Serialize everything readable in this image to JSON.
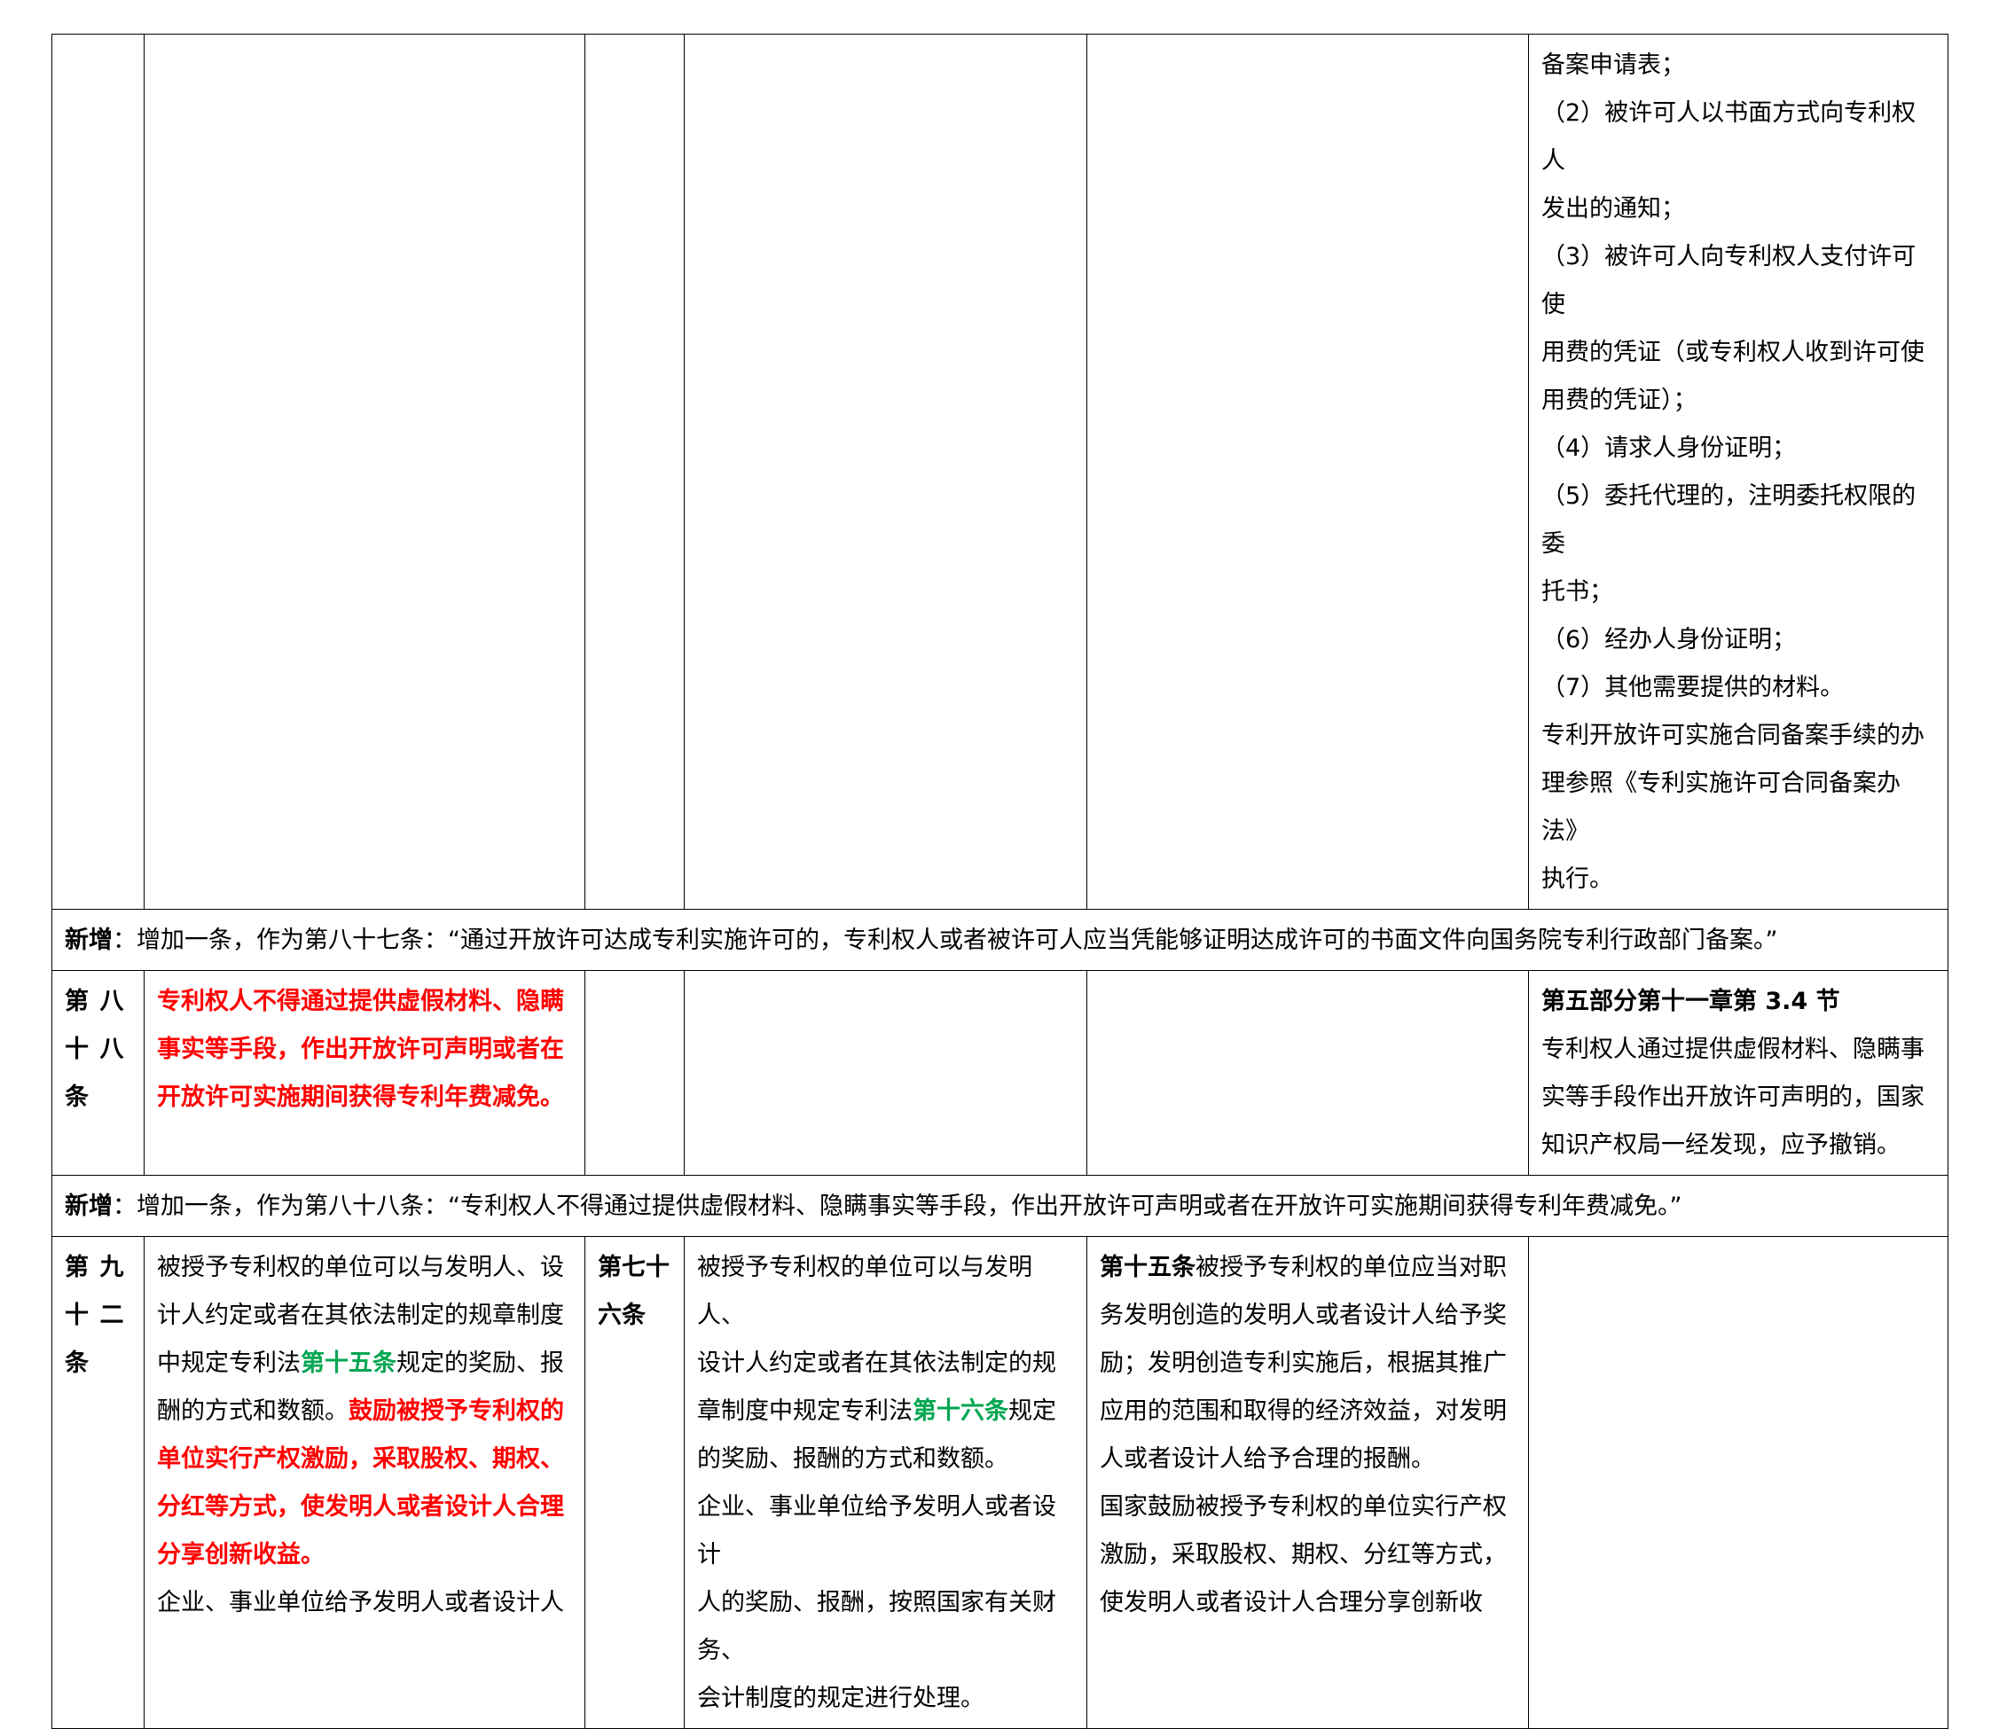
{
  "row_a": {
    "col6_lines": [
      "备案申请表；",
      "（2）被许可人以书面方式向专利权人",
      "发出的通知；",
      "（3）被许可人向专利权人支付许可使",
      "用费的凭证（或专利权人收到许可使",
      "用费的凭证）；",
      "（4）请求人身份证明；",
      "（5）委托代理的，注明委托权限的委",
      "托书；",
      "（6）经办人身份证明；",
      "（7）其他需要提供的材料。",
      "专利开放许可实施合同备案手续的办",
      "理参照《专利实施许可合同备案办法》",
      "执行。"
    ]
  },
  "note1": {
    "label": "新增",
    "text": "：增加一条，作为第八十七条：“通过开放许可达成专利实施许可的，专利权人或者被许可人应当凭能够证明达成许可的书面文件向国务院专利行政部门备案。”"
  },
  "row_b": {
    "article": [
      "第",
      "八",
      "十",
      "八",
      "条",
      ""
    ],
    "red_lines": [
      "专利权人不得通过提供虚假材料、隐瞒",
      "事实等手段，作出开放许可声明或者在",
      "开放许可实施期间获得专利年费减免。"
    ],
    "col6_heading": "第五部分第十一章第 3.4 节",
    "col6_lines": [
      "专利权人通过提供虚假材料、隐瞒事",
      "实等手段作出开放许可声明的，国家",
      "知识产权局一经发现，应予撤销。"
    ]
  },
  "note2": {
    "label": "新增",
    "text": "：增加一条，作为第八十八条：“专利权人不得通过提供虚假材料、隐瞒事实等手段，作出开放许可声明或者在开放许可实施期间获得专利年费减免。”"
  },
  "row_c": {
    "article": [
      "第",
      "九",
      "十",
      "二",
      "条",
      ""
    ],
    "col2": {
      "l1": "被授予专利权的单位可以与发明人、设",
      "l2": "计人约定或者在其依法制定的规章制度",
      "l3a": "中规定专利法",
      "l3g": "第十五条",
      "l3b": "规定的奖励、报",
      "l4a": "酬的方式和数额。",
      "l4r": "鼓励被授予专利权的",
      "r1": "单位实行产权激励，采取股权、期权、",
      "r2": "分红等方式，使发明人或者设计人合理",
      "r3": "分享创新收益。",
      "l5": "企业、事业单位给予发明人或者设计人"
    },
    "col3_article": [
      "第七十",
      "六条"
    ],
    "col4": {
      "l1": "被授予专利权的单位可以与发明人、",
      "l2": "设计人约定或者在其依法制定的规",
      "l3a": "章制度中规定专利法",
      "l3g": "第十六条",
      "l3b": "规定",
      "l4": "的奖励、报酬的方式和数额。",
      "l5": "企业、事业单位给予发明人或者设计",
      "l6": "人的奖励、报酬，按照国家有关财务、",
      "l7": "会计制度的规定进行处理。"
    },
    "col5": {
      "bold": "第十五条",
      "l1": "被授予专利权的单位应当对职",
      "l2": "务发明创造的发明人或者设计人给予奖",
      "l3": "励；发明创造专利实施后，根据其推广",
      "l4": "应用的范围和取得的经济效益，对发明",
      "l5": "人或者设计人给予合理的报酬。",
      "l6": "国家鼓励被授予专利权的单位实行产权",
      "l7": "激励，采取股权、期权、分红等方式，",
      "l8": "使发明人或者设计人合理分享创新收"
    }
  }
}
